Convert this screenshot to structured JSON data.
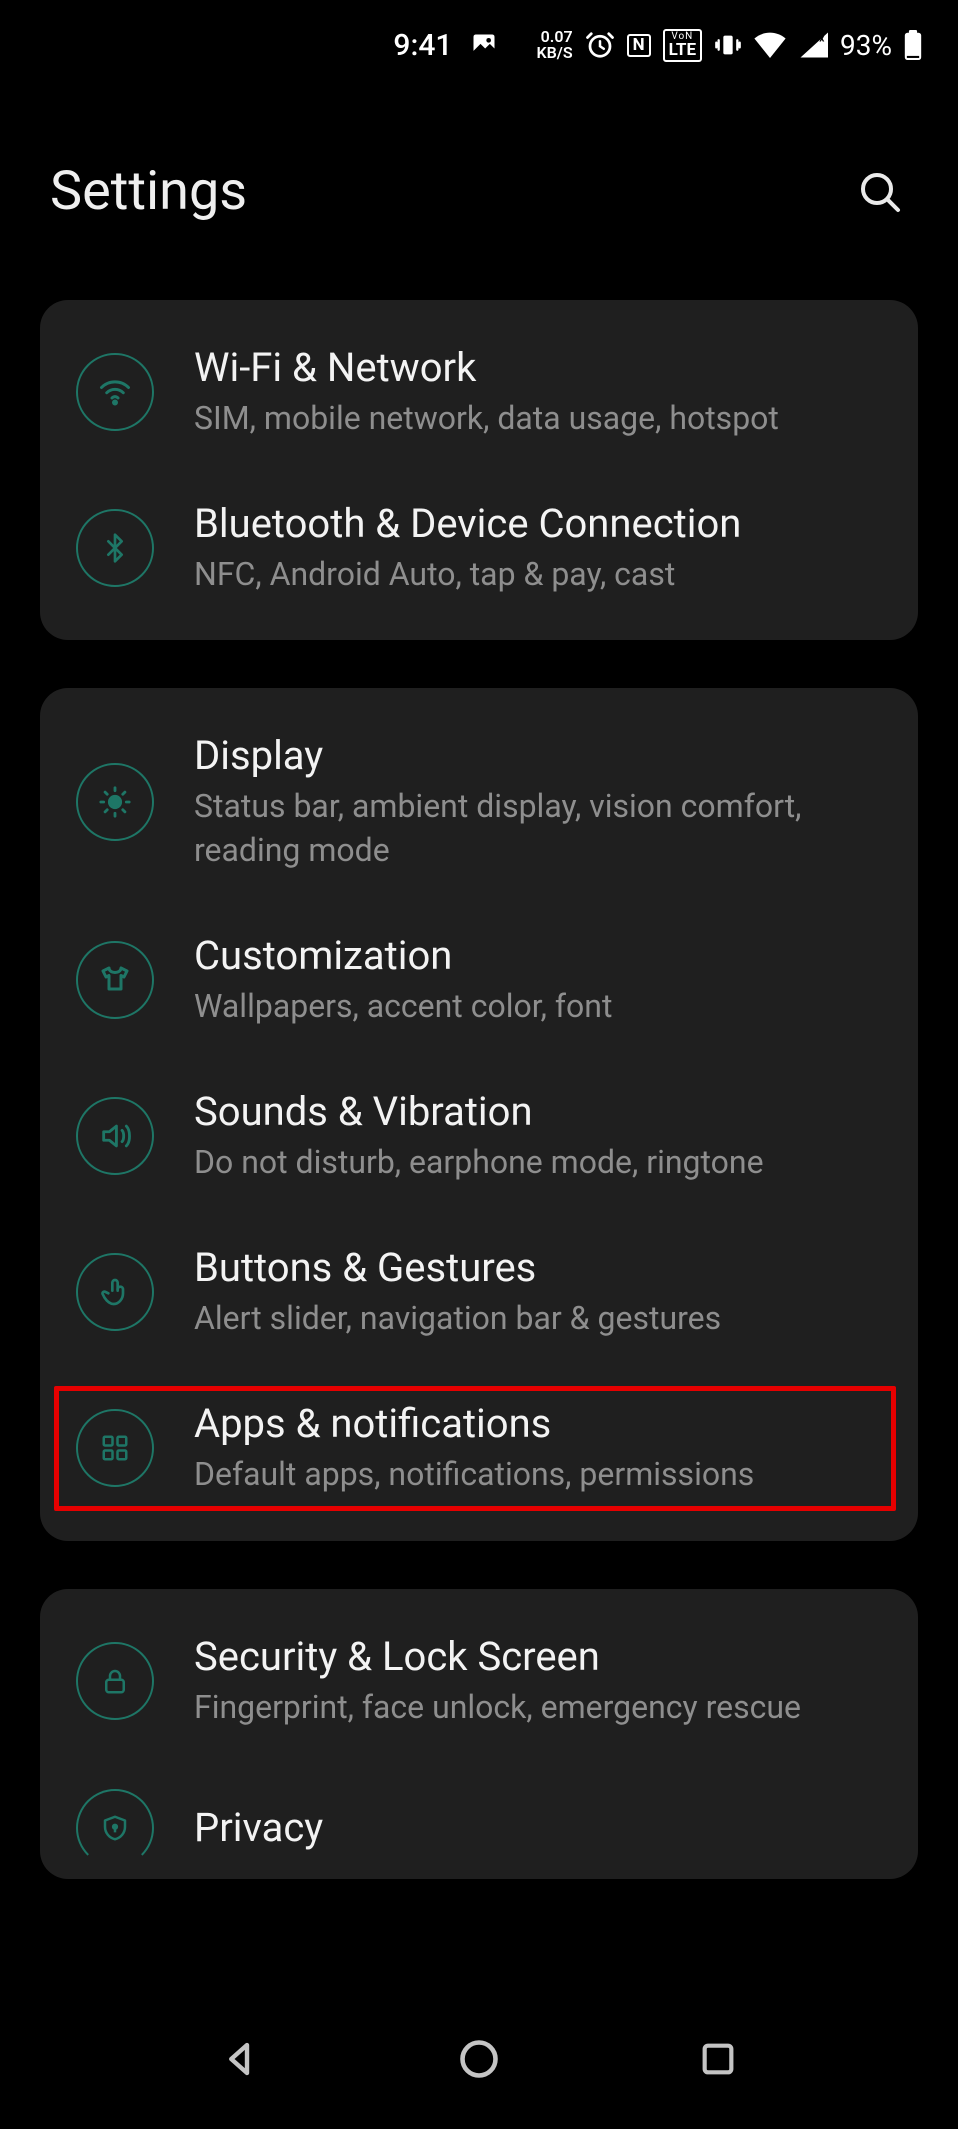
{
  "status_bar": {
    "time": "9:41",
    "kbs_top": "0.07",
    "kbs_bot": "KB/S",
    "nfc": "N",
    "volte_top": "VoN",
    "volte_bot": "LTE",
    "battery_pct": "93%"
  },
  "header": {
    "title": "Settings"
  },
  "groups": [
    {
      "items": [
        {
          "icon": "wifi-icon",
          "title": "Wi-Fi & Network",
          "sub": "SIM, mobile network, data usage, hotspot"
        },
        {
          "icon": "bluetooth-icon",
          "title": "Bluetooth & Device Connection",
          "sub": "NFC, Android Auto, tap & pay, cast"
        }
      ]
    },
    {
      "items": [
        {
          "icon": "brightness-icon",
          "title": "Display",
          "sub": "Status bar, ambient display, vision comfort, reading mode"
        },
        {
          "icon": "tshirt-icon",
          "title": "Customization",
          "sub": "Wallpapers, accent color, font"
        },
        {
          "icon": "sound-icon",
          "title": "Sounds & Vibration",
          "sub": "Do not disturb, earphone mode, ringtone"
        },
        {
          "icon": "gesture-icon",
          "title": "Buttons & Gestures",
          "sub": "Alert slider, navigation bar & gestures"
        },
        {
          "icon": "apps-icon",
          "title": "Apps & notifications",
          "sub": "Default apps, notifications, permissions",
          "highlighted": true
        }
      ]
    },
    {
      "items": [
        {
          "icon": "lock-icon",
          "title": "Security & Lock Screen",
          "sub": "Fingerprint, face unlock, emergency rescue"
        },
        {
          "icon": "shield-icon",
          "title": "Privacy",
          "sub": "",
          "partial": true
        }
      ]
    }
  ]
}
